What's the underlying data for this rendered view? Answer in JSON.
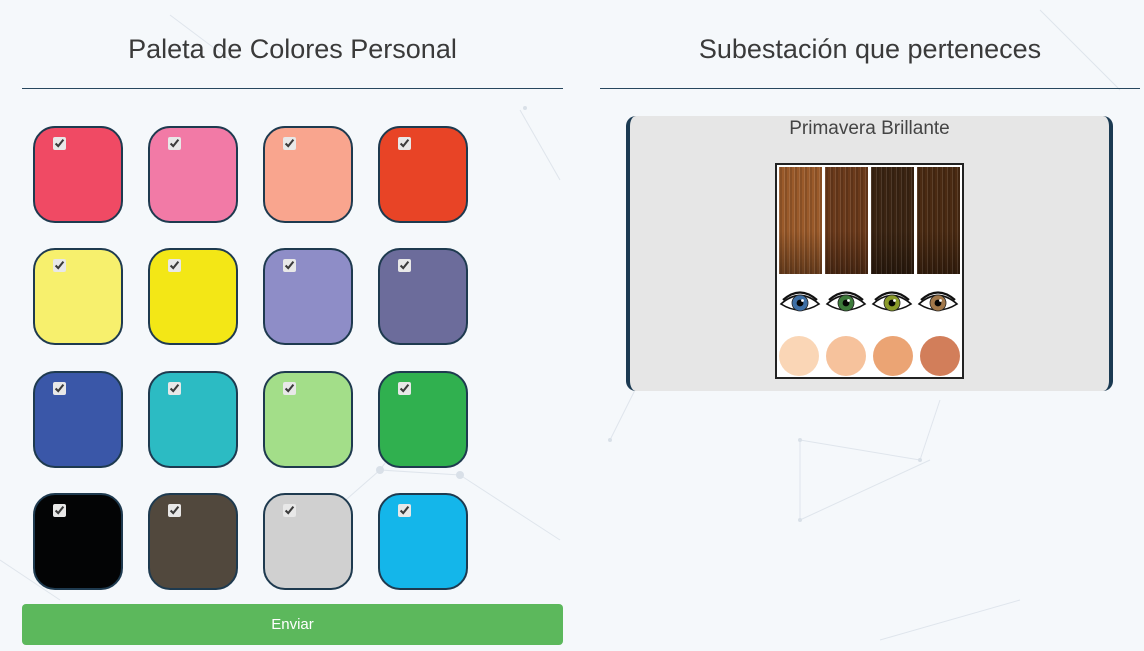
{
  "left_panel": {
    "title": "Paleta de Colores Personal",
    "swatches": [
      {
        "name": "red",
        "color": "#f04a64",
        "checked": true
      },
      {
        "name": "pink",
        "color": "#f27aa6",
        "checked": true
      },
      {
        "name": "salmon",
        "color": "#f9a58e",
        "checked": true
      },
      {
        "name": "orange-red",
        "color": "#e84426",
        "checked": true
      },
      {
        "name": "light-yellow",
        "color": "#f7f06d",
        "checked": true
      },
      {
        "name": "yellow",
        "color": "#f3e716",
        "checked": true
      },
      {
        "name": "lavender",
        "color": "#8e8dc7",
        "checked": true
      },
      {
        "name": "slate-purple",
        "color": "#6c6c9b",
        "checked": true
      },
      {
        "name": "royal-blue",
        "color": "#3a57a8",
        "checked": true
      },
      {
        "name": "teal",
        "color": "#2cbbc3",
        "checked": true
      },
      {
        "name": "light-green",
        "color": "#a3de89",
        "checked": true
      },
      {
        "name": "green",
        "color": "#30b04f",
        "checked": true
      },
      {
        "name": "black",
        "color": "#030405",
        "checked": true
      },
      {
        "name": "dark-brown",
        "color": "#51483d",
        "checked": true
      },
      {
        "name": "light-gray",
        "color": "#d0d0d0",
        "checked": true
      },
      {
        "name": "sky-blue",
        "color": "#14b6ea",
        "checked": true
      }
    ],
    "submit_label": "Enviar",
    "submit_color": "#5cb85c"
  },
  "right_panel": {
    "title": "Subestación que perteneces",
    "season_name": "Primavera Brillante",
    "hair_colors": [
      "#9a5a2a",
      "#6b3a1b",
      "#3b2412",
      "#4a2a12"
    ],
    "eye_colors": [
      "#3e6fa5",
      "#3d7a3a",
      "#8a9a2a",
      "#a2784a"
    ],
    "skin_colors": [
      "#fad6b6",
      "#f6c29c",
      "#eba474",
      "#d27e5a"
    ]
  }
}
